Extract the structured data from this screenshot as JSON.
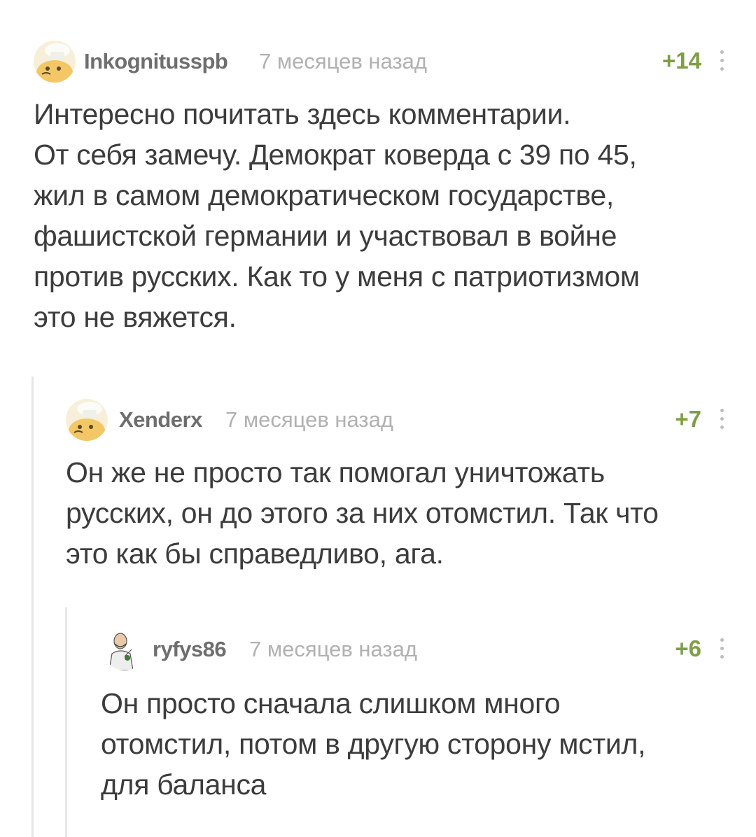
{
  "comments": [
    {
      "username": "Inkognitusspb",
      "time": "7 месяцев назад",
      "rating": "+14",
      "avatar": "chef-hat-avatar",
      "text": "Интересно почитать здесь комментарии.\nОт себя замечу. Демократ коверда с 39 по 45,\nжил в самом демократическом государстве,\nфашистской германии и участвовал в войне\nпротив русских. Как то у меня с патриотизмом\nэто не вяжется."
    },
    {
      "username": "Xenderx",
      "time": "7 месяцев назад",
      "rating": "+7",
      "avatar": "chef-hat-avatar",
      "text": "Он же не просто так помогал уничтожать\nрусских, он до этого за них отомстил. Так что\nэто как бы справедливо, ага."
    },
    {
      "username": "ryfys86",
      "time": "7 месяцев назад",
      "rating": "+6",
      "avatar": "cartoon-man-avatar",
      "text": "Он просто сначала слишком много\nотомстил, потом в другую сторону мстил,\nдля баланса"
    }
  ],
  "colors": {
    "rating": "#7f9f45",
    "username": "#6e6e6e",
    "time": "#b1b1b1",
    "text": "#3c3c3c",
    "thread_line": "#e6e6e6"
  }
}
